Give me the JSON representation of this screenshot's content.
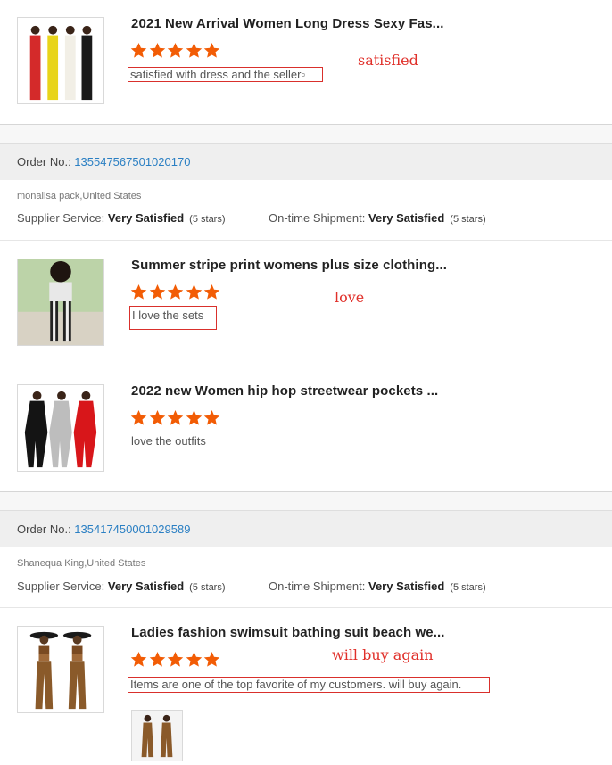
{
  "colors": {
    "star": "#f25c05",
    "link": "#2a7fc3",
    "annotation": "#e0302a"
  },
  "item1": {
    "title": "2021 New Arrival Women Long Dress Sexy Fas...",
    "rating": 5,
    "review": "satisfied with dress and the seller▫",
    "annotation": "satisfied"
  },
  "order1": {
    "label": "Order No.: ",
    "number": "135547567501020170",
    "buyer": "monalisa pack,United States",
    "supplier_label": "Supplier Service: ",
    "supplier_value": "Very Satisfied",
    "supplier_stars": "(5 stars)",
    "shipment_label": "On-time Shipment: ",
    "shipment_value": "Very Satisfied",
    "shipment_stars": "(5 stars)"
  },
  "item2": {
    "title": "Summer stripe print womens plus size clothing...",
    "rating": 5,
    "review": "I love the sets",
    "annotation": "love"
  },
  "item3": {
    "title": "2022 new Women hip hop streetwear pockets ...",
    "rating": 5,
    "review": "love the outfits"
  },
  "order2": {
    "label": "Order No.: ",
    "number": "135417450001029589",
    "buyer": "Shanequa King,United States",
    "supplier_label": "Supplier Service: ",
    "supplier_value": "Very Satisfied",
    "supplier_stars": "(5 stars)",
    "shipment_label": "On-time Shipment: ",
    "shipment_value": "Very Satisfied",
    "shipment_stars": "(5 stars)"
  },
  "item4": {
    "title": "Ladies fashion swimsuit bathing suit beach we...",
    "rating": 5,
    "review": "Items are one of the top favorite of my customers. will buy again.",
    "annotation": "will buy again"
  }
}
